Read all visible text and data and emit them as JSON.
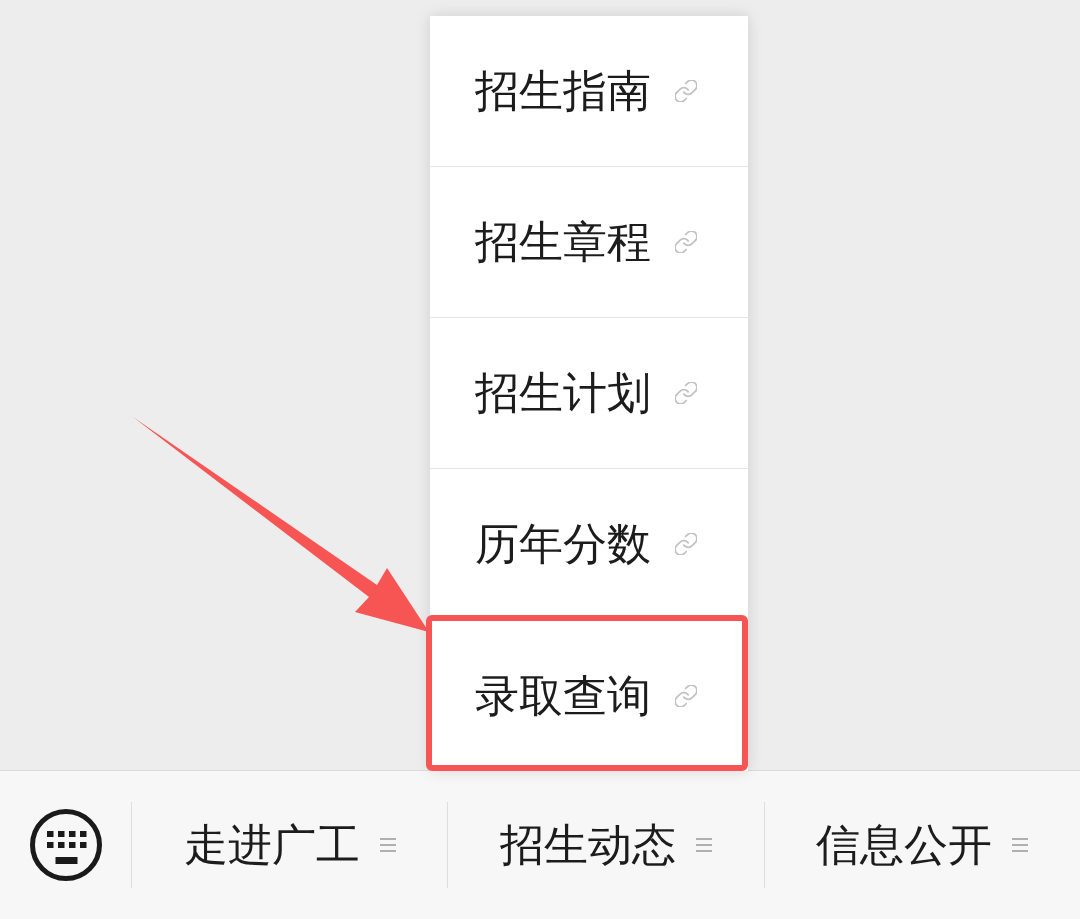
{
  "bottom_bar": {
    "tabs": [
      {
        "label": "走进广工",
        "has_submenu": true
      },
      {
        "label": "招生动态",
        "has_submenu": true,
        "menu": {
          "items": [
            {
              "label": "招生指南",
              "highlighted": false
            },
            {
              "label": "招生章程",
              "highlighted": false
            },
            {
              "label": "招生计划",
              "highlighted": false
            },
            {
              "label": "历年分数",
              "highlighted": false
            },
            {
              "label": "录取查询",
              "highlighted": true
            }
          ]
        }
      },
      {
        "label": "信息公开",
        "has_submenu": true
      }
    ]
  }
}
